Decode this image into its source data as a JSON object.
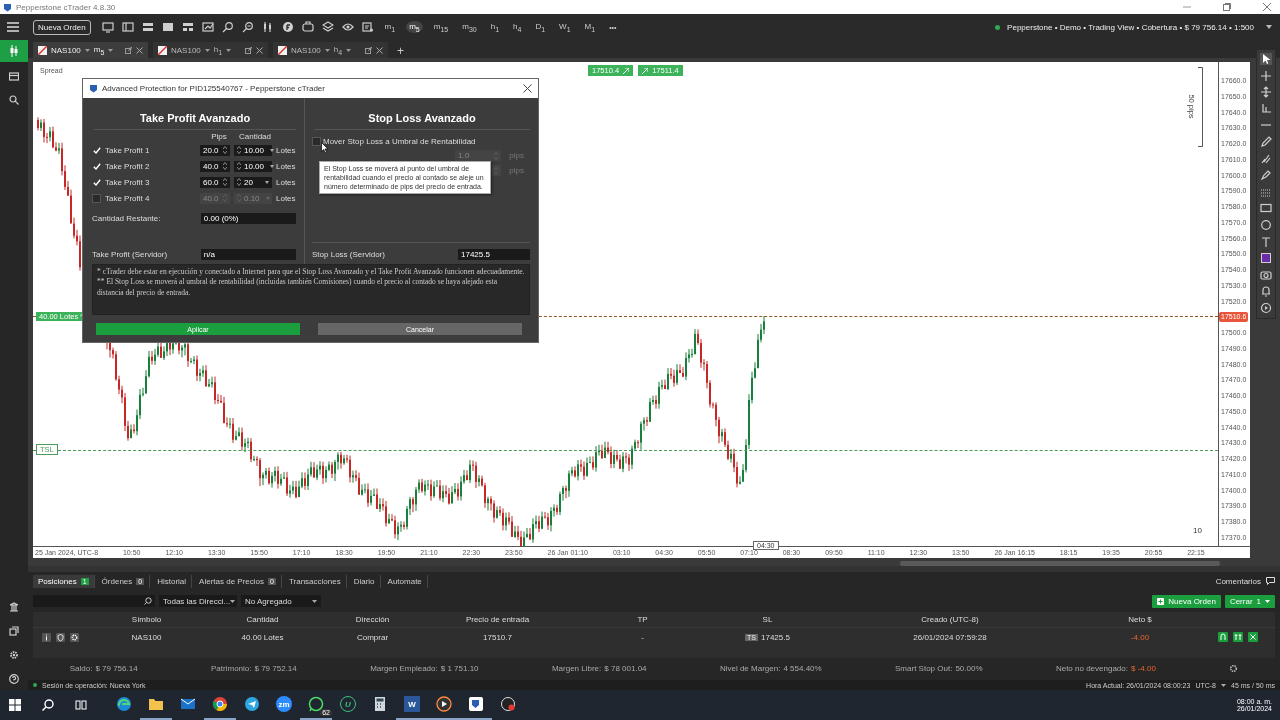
{
  "window": {
    "title": "Pepperstone cTrader 4.8.30"
  },
  "toolbar": {
    "new_order": "Nueva Orden",
    "timeframes": [
      {
        "label": "m$_{1}$",
        "selected": false
      },
      {
        "label": "m$_{5}$",
        "selected": true
      },
      {
        "label": "m$_{15}$",
        "selected": false
      },
      {
        "label": "m$_{30}$",
        "selected": false
      },
      {
        "label": "h$_{1}$",
        "selected": false
      },
      {
        "label": "h$_{4}$",
        "selected": false
      },
      {
        "label": "D$_{1}$",
        "selected": false
      },
      {
        "label": "W$_{1}$",
        "selected": false
      },
      {
        "label": "M$_{1}$",
        "selected": false
      }
    ],
    "more": "•••",
    "account": "Pepperstone • Demo • Trading View • Cobertura • $ 79 756.14 • 1:500"
  },
  "chart_tabs": [
    {
      "symbol": "NAS100",
      "timeframe": "m$_{5}$",
      "selected": true
    },
    {
      "symbol": "NAS100",
      "timeframe": "h$_{1}$",
      "selected": false
    },
    {
      "symbol": "NAS100",
      "timeframe": "h$_{4}$",
      "selected": false
    }
  ],
  "new_tab": "+",
  "chart": {
    "spread_label": "Spread",
    "badges": [
      "17510.4",
      "17511.4"
    ],
    "price_axis": [
      {
        "kind": "tick",
        "text": "17660.0"
      },
      {
        "kind": "tick",
        "text": "17650.0"
      },
      {
        "kind": "tick",
        "text": "17640.0"
      },
      {
        "kind": "tick",
        "text": "17630.0"
      },
      {
        "kind": "tick",
        "text": "17620.0"
      },
      {
        "kind": "tick",
        "text": "17610.0"
      },
      {
        "kind": "tick",
        "text": "17600.0"
      },
      {
        "kind": "tick",
        "text": "17590.0"
      },
      {
        "kind": "tick",
        "text": "17580.0"
      },
      {
        "kind": "tick",
        "text": "17570.0"
      },
      {
        "kind": "tick",
        "text": "17560.0"
      },
      {
        "kind": "tick",
        "text": "17550.0"
      },
      {
        "kind": "tick",
        "text": "17540.0"
      },
      {
        "kind": "tick",
        "text": "17530.0"
      },
      {
        "kind": "tick",
        "text": "17520.0"
      },
      {
        "kind": "current",
        "text": "17510.6"
      },
      {
        "kind": "tick",
        "text": "17500.0"
      },
      {
        "kind": "tick",
        "text": "17490.0"
      },
      {
        "kind": "tick",
        "text": "17480.0"
      },
      {
        "kind": "tick",
        "text": "17470.0"
      },
      {
        "kind": "tick",
        "text": "17460.0"
      },
      {
        "kind": "tick",
        "text": "17450.0"
      },
      {
        "kind": "tick",
        "text": "17440.0"
      },
      {
        "kind": "tick",
        "text": "17430.0"
      },
      {
        "kind": "tick",
        "text": "17420.0"
      },
      {
        "kind": "tick",
        "text": "17410.0"
      },
      {
        "kind": "tick",
        "text": "17400.0"
      },
      {
        "kind": "tick",
        "text": "17390.0"
      },
      {
        "kind": "tick",
        "text": "17380.0"
      },
      {
        "kind": "tick",
        "text": "17370.0"
      }
    ],
    "position_tag": "40.00 Lotes",
    "tsl_tag": "TSL",
    "pips_label": "50 pips",
    "corner_number": "10",
    "time_labels": [
      "25 Jan 2024, UTC-8",
      "10:50",
      "12:10",
      "13:30",
      "15:50",
      "17:10",
      "18:30",
      "19:50",
      "21:10",
      "22:30",
      "23:50",
      "26 Jan 01:10",
      "03:10",
      "04:30",
      "05:50",
      "07:10",
      "08:30",
      "09:50",
      "11:10",
      "12:30",
      "13:50",
      "26 Jan 16:15",
      "18:15",
      "19:35",
      "20:55",
      "22:15"
    ],
    "cursor_time": "04:30"
  },
  "dialog": {
    "title": "Advanced Protection for PID125540767 - Pepperstone cTrader",
    "tp_title": "Take Profit Avanzado",
    "pips_header": "Pips",
    "amount_header": "Cantidad",
    "take_profits": [
      {
        "label": "Take Profit 1",
        "checked": true,
        "pips": "20.0",
        "amount": "10.00",
        "unit": "Lotes"
      },
      {
        "label": "Take Profit 2",
        "checked": true,
        "pips": "40.0",
        "amount": "10.00",
        "unit": "Lotes"
      },
      {
        "label": "Take Profit 3",
        "checked": true,
        "pips": "60.0",
        "amount": "20",
        "unit": "Lotes"
      },
      {
        "label": "Take Profit 4",
        "checked": false,
        "pips": "40.0",
        "amount": "0.10",
        "unit": "Lotes"
      }
    ],
    "remaining": {
      "label": "Cantidad Restante:",
      "value": "0.00 (0%)"
    },
    "tp_server": {
      "label": "Take Profit (Servidor)",
      "value": "n/a"
    },
    "sl_title": "Stop Loss Avanzado",
    "breakeven": {
      "label": "Mover Stop Loss a Umbral de Rentabilidad",
      "checked": false
    },
    "breakeven_rows": [
      {
        "value": "1.0",
        "unit": "pips"
      },
      {
        "unit": "pips"
      }
    ],
    "tooltip": "El Stop Loss se moverá al punto del umbral de rentabilidad cuando el precio al contado se aleje un número determinado de pips del precio de entrada.",
    "sl_server": {
      "label": "Stop Loss (Servidor)",
      "value": "17425.5"
    },
    "notes": [
      "* cTrader debe estar en ejecución y conectado a Internet para que el Stop Loss Avanzado y el Take Profit Avanzado funcionen adecuadamente.",
      "** El Stop Loss se moverá al umbral de rentabilidad (incluidas también Comisiones) cuando el precio al contado se haya alejado esta distancia del precio de entrada."
    ],
    "apply": "Aplicar",
    "cancel": "Cancelar"
  },
  "panel": {
    "tabs": [
      {
        "label": "Posiciones",
        "count": "1",
        "selected": true
      },
      {
        "label": "Órdenes",
        "count": "0",
        "selected": false
      },
      {
        "label": "Historial",
        "selected": false
      },
      {
        "label": "Alertas de Precios",
        "count": "0",
        "selected": false
      },
      {
        "label": "Transacciones",
        "selected": false
      },
      {
        "label": "Diario",
        "selected": false
      },
      {
        "label": "Automate",
        "selected": false
      }
    ],
    "comments": "Comentarios",
    "direction_filter": "Todas las Direcci...",
    "aggregate_filter": "No Agregado",
    "new_order": "Nueva Orden",
    "close": {
      "label": "Cerrar",
      "count": "1"
    },
    "columns": [
      "Símbolo",
      "Cantidad",
      "Dirección",
      "Precio de entrada",
      "TP",
      "SL",
      "Creado (UTC-8)",
      "Neto $"
    ],
    "rows": [
      {
        "symbol": "NAS100",
        "quantity": "40.00 Lotes",
        "direction": "Comprar",
        "entry": "17510.7",
        "tp": "-",
        "sl_badge": "TS",
        "sl": "17425.5",
        "created": "26/01/2024 07:59:28",
        "net": "-4.00"
      }
    ],
    "summary": [
      {
        "label": "Saldo:",
        "value": "$ 79 756.14",
        "negative": false
      },
      {
        "label": "Patrimonio:",
        "value": "$ 79 752.14",
        "negative": false
      },
      {
        "label": "Margen Empleado:",
        "value": "$ 1 751.10",
        "negative": false
      },
      {
        "label": "Margen Libre:",
        "value": "$ 78 001.04",
        "negative": false
      },
      {
        "label": "Nivel de Margen:",
        "value": "4 554.40%",
        "negative": false
      },
      {
        "label": "Smart Stop Out:",
        "value": "50.00%",
        "negative": false
      },
      {
        "label": "Neto no devengado:",
        "value": "$ -4.00",
        "negative": true
      }
    ]
  },
  "status": {
    "session": "Sesión de operación: Nueva York",
    "time": "Hora Actual: 26/01/2024 08:00:23",
    "timezone": "UTC-8",
    "latency": "45 ms / 50 ms"
  },
  "taskbar": {
    "apps": [
      {
        "kind": "edge",
        "running": false
      },
      {
        "kind": "folder",
        "running": true
      },
      {
        "kind": "mail",
        "running": false
      },
      {
        "kind": "chrome",
        "running": true
      },
      {
        "kind": "telegram",
        "running": false
      },
      {
        "kind": "zoom",
        "glyph": "zm",
        "running": false
      },
      {
        "kind": "whatsapp",
        "badge": "62",
        "running": true
      },
      {
        "kind": "letter",
        "glyph": "U",
        "running": false
      },
      {
        "kind": "calculator",
        "running": false
      },
      {
        "kind": "word",
        "glyph": "W",
        "running": true
      },
      {
        "kind": "player",
        "running": true
      },
      {
        "kind": "ctrader",
        "running": true
      },
      {
        "kind": "record",
        "running": false
      }
    ],
    "time": "08:00 a. m.",
    "date": "26/01/2024"
  }
}
